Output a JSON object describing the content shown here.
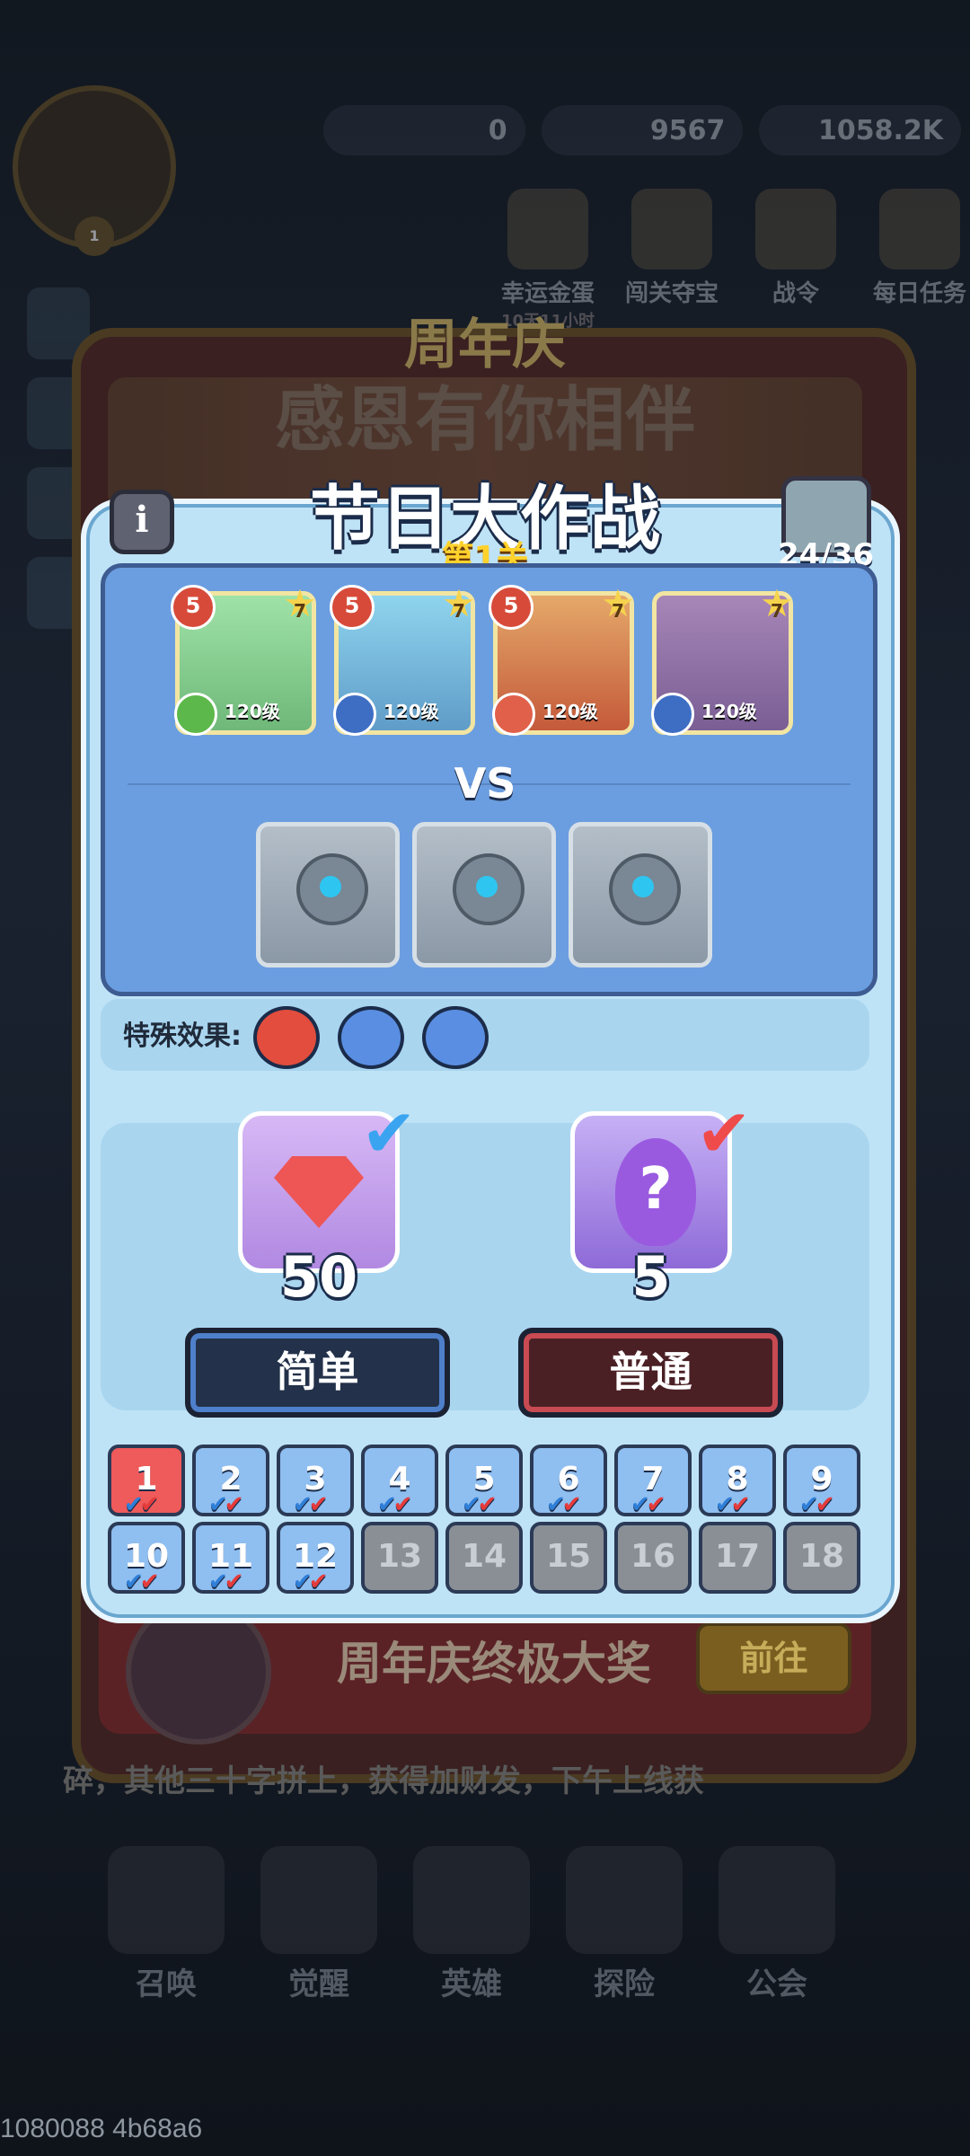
{
  "hud": {
    "resources": [
      "0",
      "9567",
      "1058.2K"
    ],
    "top_icons": [
      {
        "label": "幸运金蛋",
        "sub": "10天11小时"
      },
      {
        "label": "闯关夺宝",
        "sub": ""
      },
      {
        "label": "战令",
        "sub": ""
      },
      {
        "label": "每日任务",
        "sub": ""
      }
    ],
    "player_level": "1"
  },
  "event": {
    "title_line1": "周年庆",
    "title_line2": "感恩有你相伴",
    "grand_prize_label": "周年庆终极大奖",
    "goto_label": "前往",
    "bottom_text": "碎，其他三十字拼上，获得加财发，下午上线获"
  },
  "modal": {
    "title": "节日大作战",
    "stage": "第1关",
    "progress": "24/36",
    "info_icon": "i",
    "heroes": [
      {
        "level": "120级",
        "rank": "5",
        "stars": "7",
        "element": "nature"
      },
      {
        "level": "120级",
        "rank": "5",
        "stars": "7",
        "element": "water"
      },
      {
        "level": "120级",
        "rank": "5",
        "stars": "7",
        "element": "fire"
      },
      {
        "level": "120级",
        "rank": "",
        "stars": "7",
        "element": "water"
      }
    ],
    "vs": "VS",
    "enemies": [
      "robot",
      "gear-robot",
      "robot"
    ],
    "special_effects_label": "特殊效果:",
    "special_effects": [
      "devil-face",
      "blue-face",
      "blue-face"
    ],
    "rewards": [
      {
        "icon": "gem",
        "amount": "50",
        "claimed": true
      },
      {
        "icon": "mystery-egg",
        "amount": "5",
        "claimed": true
      }
    ],
    "difficulty": {
      "easy": "简单",
      "normal": "普通"
    },
    "levels": [
      {
        "n": "1",
        "state": "current"
      },
      {
        "n": "2",
        "state": "done"
      },
      {
        "n": "3",
        "state": "done"
      },
      {
        "n": "4",
        "state": "done"
      },
      {
        "n": "5",
        "state": "done"
      },
      {
        "n": "6",
        "state": "done"
      },
      {
        "n": "7",
        "state": "done"
      },
      {
        "n": "8",
        "state": "done"
      },
      {
        "n": "9",
        "state": "done"
      },
      {
        "n": "10",
        "state": "done"
      },
      {
        "n": "11",
        "state": "done"
      },
      {
        "n": "12",
        "state": "done"
      },
      {
        "n": "13",
        "state": "locked"
      },
      {
        "n": "14",
        "state": "locked"
      },
      {
        "n": "15",
        "state": "locked"
      },
      {
        "n": "16",
        "state": "locked"
      },
      {
        "n": "17",
        "state": "locked"
      },
      {
        "n": "18",
        "state": "locked"
      }
    ]
  },
  "bottom_nav": [
    "召唤",
    "觉醒",
    "英雄",
    "探险",
    "公会"
  ],
  "debug_text": "1080088 4b68a6",
  "colors": {
    "check_easy": "#3aa4f0",
    "check_normal": "#ef4b4b",
    "stage_gold": "#ffd22c"
  }
}
